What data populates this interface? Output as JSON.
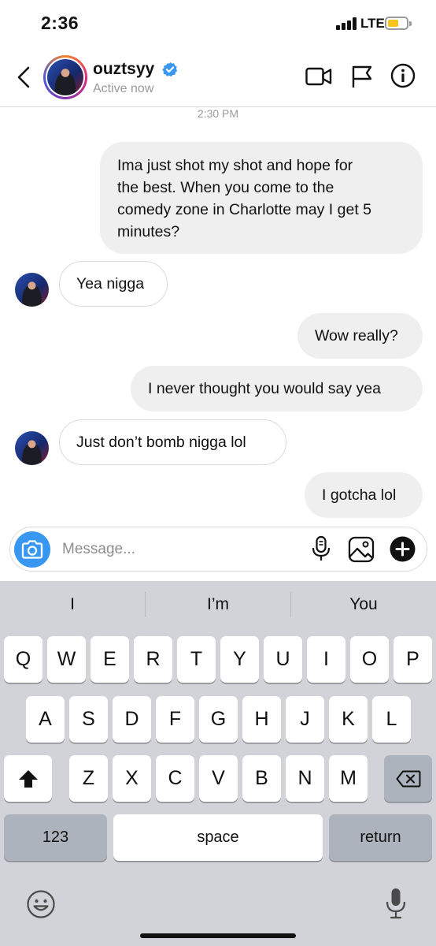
{
  "status_bar": {
    "time": "2:36",
    "network": "LTE",
    "battery_color": "#f6c51c"
  },
  "header": {
    "username": "ouztsyy",
    "status": "Active now",
    "verified": true,
    "icons": [
      "back-chevron-icon",
      "video-call-icon",
      "flag-icon",
      "info-icon"
    ]
  },
  "chat": {
    "timestamp": "2:30 PM",
    "messages": [
      {
        "sender": "me",
        "lines": [
          "Ima just shot my shot and hope for",
          "the best. When you come to the",
          "comedy zone in Charlotte may I get 5",
          "minutes?"
        ]
      },
      {
        "sender": "them",
        "lines": [
          "Yea nigga"
        ]
      },
      {
        "sender": "me",
        "lines": [
          "Wow really?"
        ]
      },
      {
        "sender": "me",
        "lines": [
          "I never thought you would say yea"
        ]
      },
      {
        "sender": "them",
        "lines": [
          "Just don’t bomb nigga lol"
        ]
      },
      {
        "sender": "me",
        "lines": [
          "I gotcha lol"
        ]
      }
    ]
  },
  "composer": {
    "placeholder": "Message...",
    "icons": [
      "camera-icon",
      "microphone-icon",
      "gallery-icon",
      "plus-icon"
    ],
    "accent": "#3897f0"
  },
  "keyboard": {
    "suggestions": [
      "I",
      "I’m",
      "You"
    ],
    "row1": [
      "Q",
      "W",
      "E",
      "R",
      "T",
      "Y",
      "U",
      "I",
      "O",
      "P"
    ],
    "row2": [
      "A",
      "S",
      "D",
      "F",
      "G",
      "H",
      "J",
      "K",
      "L"
    ],
    "row3": [
      "Z",
      "X",
      "C",
      "V",
      "B",
      "N",
      "M"
    ],
    "numbers_label": "123",
    "space_label": "space",
    "return_label": "return",
    "icons": [
      "shift-icon",
      "backspace-icon",
      "emoji-icon",
      "dictation-icon"
    ]
  }
}
